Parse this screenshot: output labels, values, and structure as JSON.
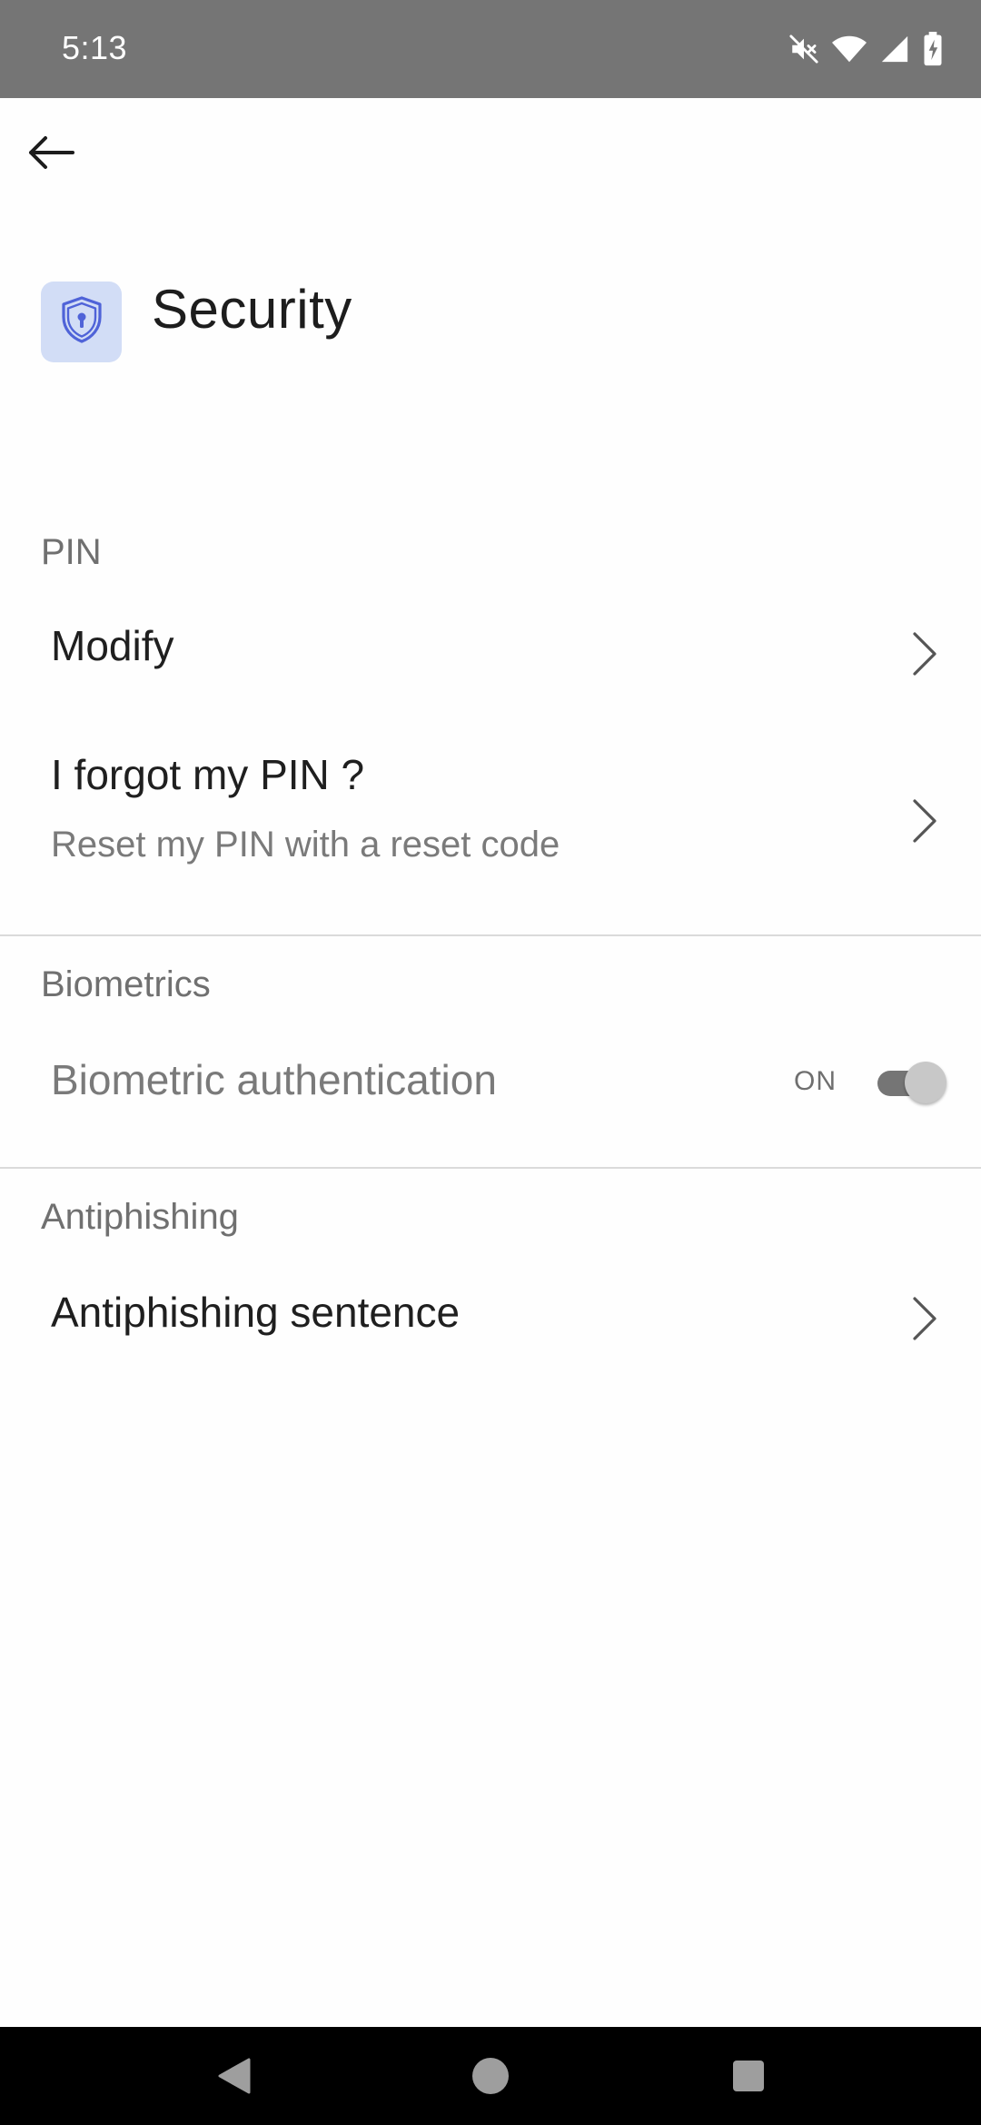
{
  "status_bar": {
    "time": "5:13",
    "icons": [
      "mute-icon",
      "wifi-icon",
      "signal-icon",
      "battery-charging-icon"
    ]
  },
  "app_bar": {
    "back_icon": "arrow-left-icon"
  },
  "header": {
    "icon": "shield-lock-icon",
    "title": "Security",
    "icon_tile_color": "#d2ddf6",
    "icon_color": "#4f63d8"
  },
  "sections": {
    "pin": {
      "label": "PIN",
      "modify": {
        "title": "Modify"
      },
      "forgot": {
        "title": "I forgot my PIN ?",
        "subtitle": "Reset my PIN with a reset code"
      }
    },
    "biometrics": {
      "label": "Biometrics",
      "auth": {
        "title": "Biometric authentication",
        "state_label": "ON",
        "enabled": true
      }
    },
    "antiphishing": {
      "label": "Antiphishing",
      "sentence": {
        "title": "Antiphishing sentence"
      }
    }
  },
  "nav_bar": {
    "buttons": [
      "back-triangle-icon",
      "home-circle-icon",
      "recents-square-icon"
    ]
  },
  "colors": {
    "status_bar": "#757575",
    "nav_bar": "#000000",
    "divider": "#dadada",
    "section_label": "#707070"
  }
}
